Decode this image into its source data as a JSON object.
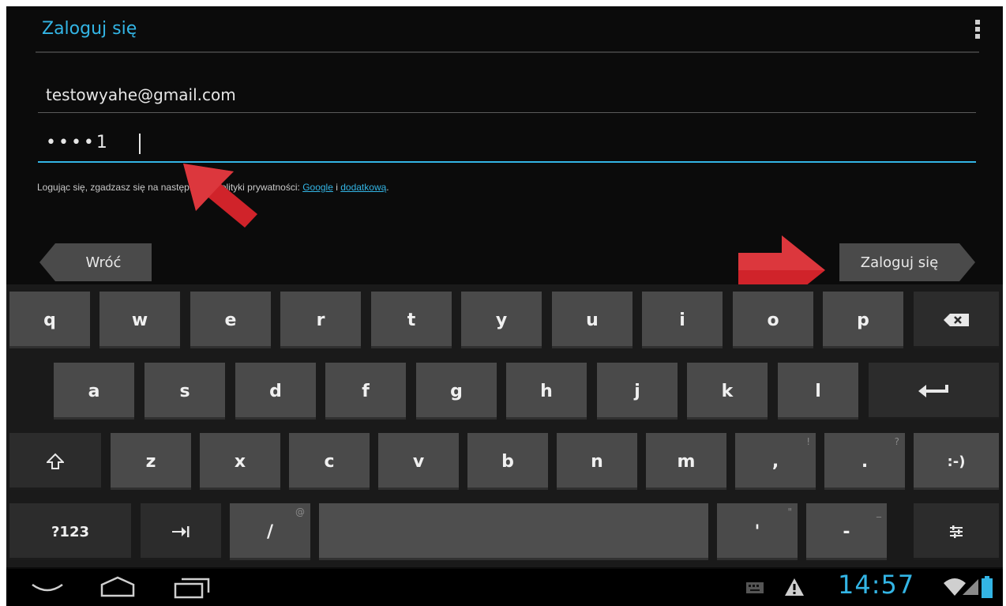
{
  "header": {
    "title": "Zaloguj się"
  },
  "form": {
    "email": "testowyahe@gmail.com",
    "password_masked": "••••1",
    "privacy_prefix": "Logując się, zgadzasz się na następujące Polityki prywatności: ",
    "privacy_link_google": "Google",
    "privacy_separator": " i ",
    "privacy_link_extra": "dodatkową",
    "privacy_suffix": "."
  },
  "actions": {
    "back": "Wróć",
    "sign_in": "Zaloguj się"
  },
  "keyboard": {
    "row1": [
      "q",
      "w",
      "e",
      "r",
      "t",
      "y",
      "u",
      "i",
      "o",
      "p"
    ],
    "row2": [
      "a",
      "s",
      "d",
      "f",
      "g",
      "h",
      "j",
      "k",
      "l"
    ],
    "row3": [
      "z",
      "x",
      "c",
      "v",
      "b",
      "n",
      "m"
    ],
    "comma": ",",
    "comma_hint": "!",
    "period": ".",
    "period_hint": "?",
    "smiley": ":-)",
    "symbols": "?123",
    "slash": "/",
    "slash_hint": "@",
    "apostrophe": "'",
    "apostrophe_hint": "\"",
    "dash": "-",
    "dash_hint": "_"
  },
  "status": {
    "time": "14:57"
  },
  "icons": {
    "backspace": "backspace-icon",
    "enter": "enter-icon",
    "shift": "shift-icon",
    "tab": "tab-icon",
    "settings": "keyboard-settings-icon",
    "nav_back": "nav-back-icon",
    "nav_home": "nav-home-icon",
    "nav_recent": "nav-recent-icon",
    "keyboard_status": "keyboard-status-icon",
    "warning": "warning-icon",
    "wifi": "wifi-icon",
    "signal": "signal-icon",
    "battery": "battery-icon"
  },
  "colors": {
    "accent": "#33b5e5",
    "key": "#4a4a4a",
    "background": "#0b0b0b",
    "arrow": "#d0232a"
  }
}
